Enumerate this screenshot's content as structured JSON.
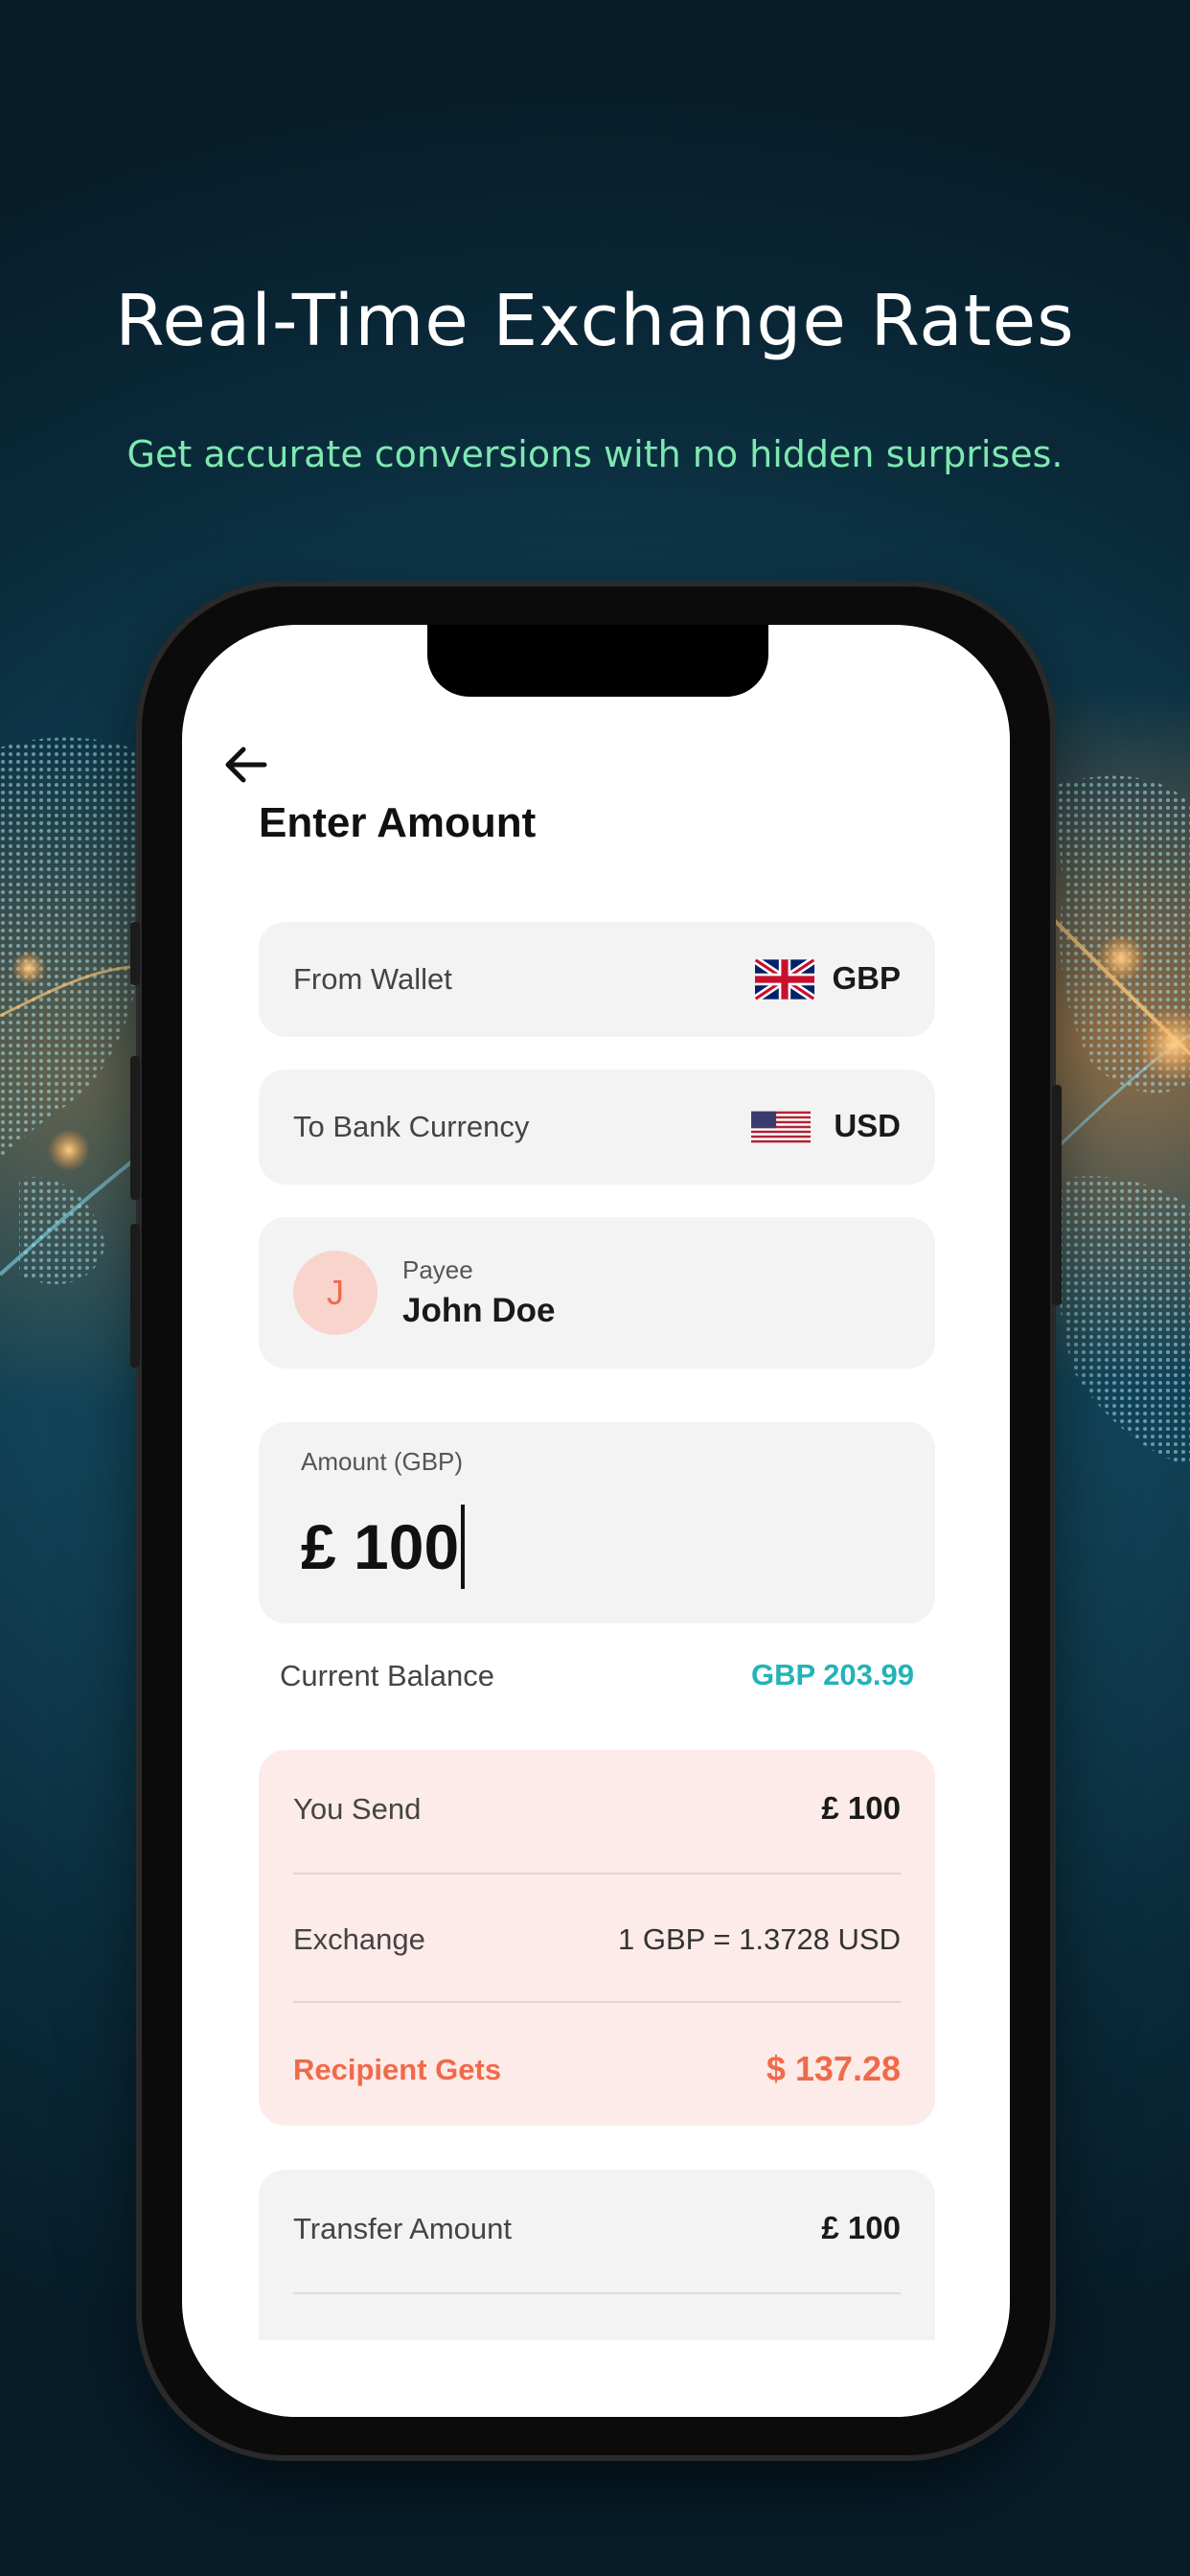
{
  "promo": {
    "headline": "Real-Time Exchange Rates",
    "subheadline": "Get accurate conversions with no hidden surprises."
  },
  "screen": {
    "title": "Enter Amount",
    "from_wallet": {
      "label": "From Wallet",
      "currency": "GBP",
      "flag_icon": "uk-flag-icon"
    },
    "to_bank": {
      "label": "To Bank Currency",
      "currency": "USD",
      "flag_icon": "us-flag-icon"
    },
    "payee": {
      "initial": "J",
      "label": "Payee",
      "name": "John Doe"
    },
    "amount": {
      "label": "Amount (GBP)",
      "value": "£ 100"
    },
    "balance": {
      "label": "Current Balance",
      "value": "GBP 203.99"
    },
    "summary": {
      "you_send_label": "You Send",
      "you_send_value": "£ 100",
      "exchange_label": "Exchange",
      "exchange_value": "1 GBP = 1.3728 USD",
      "recipient_label": "Recipient Gets",
      "recipient_value": "$ 137.28"
    },
    "transfer": {
      "label": "Transfer Amount",
      "value": "£ 100"
    }
  },
  "colors": {
    "accent_orange": "#f06a4a",
    "accent_teal": "#22b3b8",
    "subheadline_green": "#7ee8b0"
  }
}
